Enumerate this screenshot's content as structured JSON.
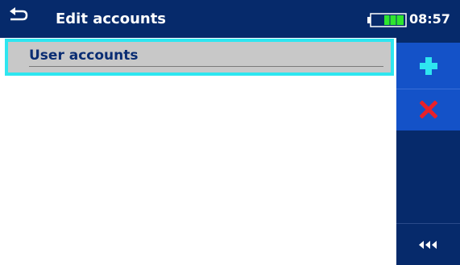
{
  "header": {
    "title": "Edit accounts",
    "time": "08:57",
    "back_icon": "return-arrow-icon",
    "battery_icon": "battery-icon",
    "battery_level": 0.6
  },
  "list": {
    "items": [
      {
        "label": "User accounts",
        "selected": true
      }
    ]
  },
  "sidebar": {
    "buttons": [
      {
        "icon": "plus-icon"
      },
      {
        "icon": "delete-x-icon"
      },
      {
        "icon": "triple-left-arrow-icon"
      }
    ]
  },
  "colors": {
    "header_bg": "#062a6b",
    "sidebar_bg": "#062a6b",
    "button_active_bg": "#1452c8",
    "selection_border": "#2ee6f0",
    "item_bg": "#c8c8c8",
    "item_text": "#0a2d73",
    "plus": "#2ee6f0",
    "delete": "#e8202a",
    "battery": "#2ee62e"
  }
}
